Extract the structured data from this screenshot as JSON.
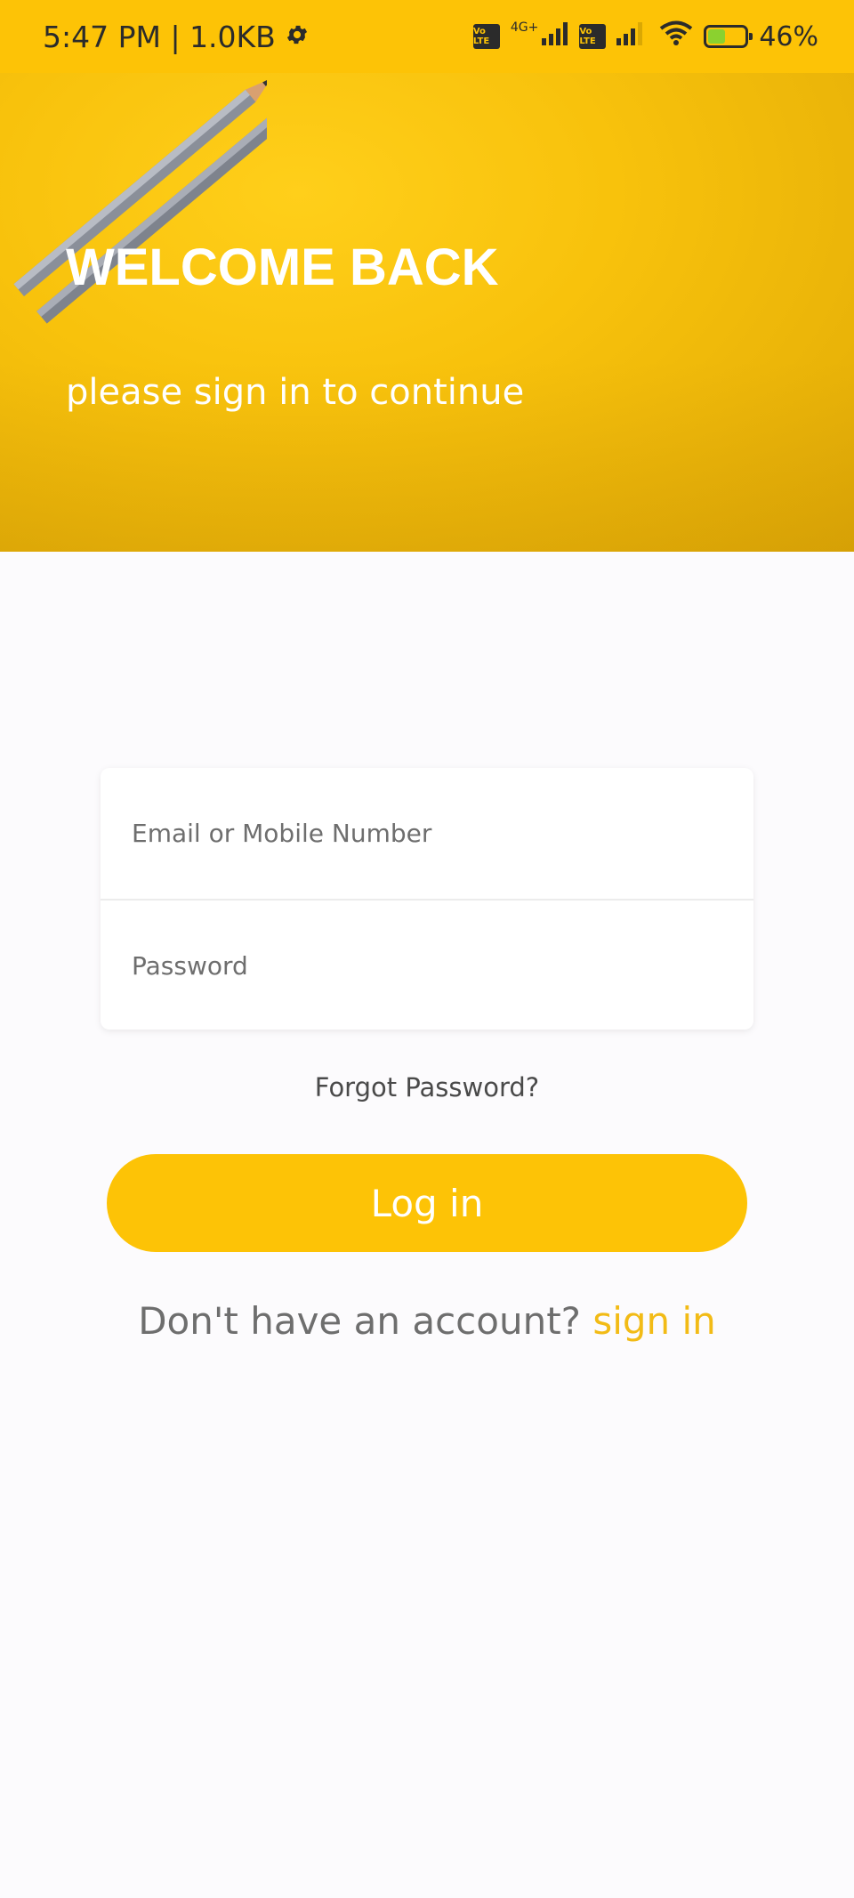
{
  "status_bar": {
    "time_data": "5:47 PM | 1.0KB",
    "volte_1": "Vo LTE",
    "network_1": "4G+",
    "volte_2": "Vo LTE",
    "battery": "46%",
    "battery_level": 0.46
  },
  "hero": {
    "title": "WELCOME BACK",
    "subtitle": "please sign in to continue"
  },
  "form": {
    "email_placeholder": "Email or Mobile Number",
    "password_placeholder": "Password"
  },
  "forgot_password": "Forgot Password?",
  "login_button": "Log in",
  "signup_prompt": "Don't have an account?",
  "signup_link": "sign in",
  "colors": {
    "accent": "#fdc306",
    "link": "#f2bb16",
    "background": "#fcfbfd"
  }
}
